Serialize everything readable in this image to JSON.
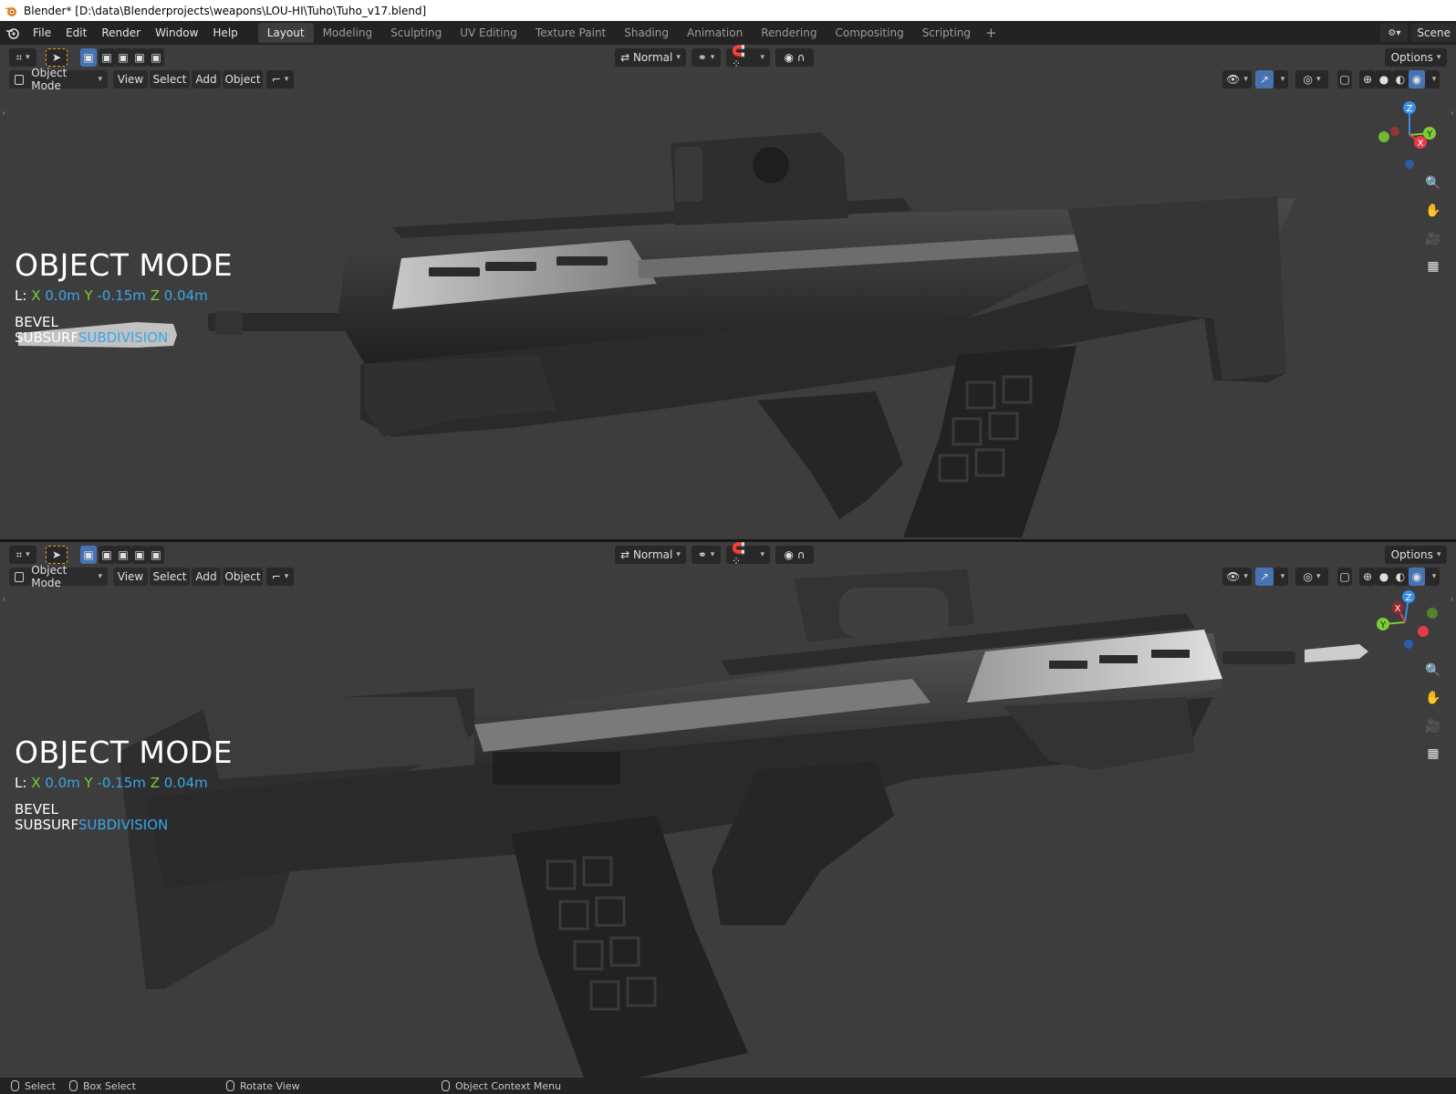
{
  "window": {
    "title": "Blender* [D:\\data\\Blenderprojects\\weapons\\LOU-HI\\Tuho\\Tuho_v17.blend]"
  },
  "menu": [
    "File",
    "Edit",
    "Render",
    "Window",
    "Help"
  ],
  "workspaces": [
    "Layout",
    "Modeling",
    "Sculpting",
    "UV Editing",
    "Texture Paint",
    "Shading",
    "Animation",
    "Rendering",
    "Compositing",
    "Scripting"
  ],
  "active_workspace": "Layout",
  "scene": {
    "label": "Scene"
  },
  "viewports": [
    {
      "toolbar": {
        "orientation": "Normal",
        "options": "Options"
      },
      "header": {
        "mode": "Object Mode",
        "menus": [
          "View",
          "Select",
          "Add",
          "Object"
        ]
      },
      "overlay": {
        "mode_title": "OBJECT MODE",
        "loc_label": "L:",
        "x_label": "X",
        "x_val": "0.0m",
        "y_label": "Y",
        "y_val": "-0.15m",
        "z_label": "Z",
        "z_val": "0.04m",
        "mod_line1": "BEVEL",
        "mod_line2_a": "SUBSURF",
        "mod_line2_b": "SUBDIVISION"
      },
      "gizmo_axes": {
        "z": "Z",
        "y": "Y",
        "x": "X"
      }
    },
    {
      "toolbar": {
        "orientation": "Normal",
        "options": "Options"
      },
      "header": {
        "mode": "Object Mode",
        "menus": [
          "View",
          "Select",
          "Add",
          "Object"
        ]
      },
      "overlay": {
        "mode_title": "OBJECT MODE",
        "loc_label": "L:",
        "x_label": "X",
        "x_val": "0.0m",
        "y_label": "Y",
        "y_val": "-0.15m",
        "z_label": "Z",
        "z_val": "0.04m",
        "mod_line1": "BEVEL",
        "mod_line2_a": "SUBSURF",
        "mod_line2_b": "SUBDIVISION"
      },
      "gizmo_axes": {
        "z": "Z",
        "y": "Y",
        "x": "X"
      }
    }
  ],
  "statusbar": {
    "select": "Select",
    "box_select": "Box Select",
    "rotate": "Rotate View",
    "context_menu": "Object Context Menu"
  },
  "colors": {
    "viewport_bg": "#3d3d3d",
    "header_bg": "#232323",
    "accent_blue": "#4772b3",
    "axis_x": "#e8394a",
    "axis_y": "#7ccd35",
    "axis_z": "#3a8ee8",
    "overlay_value": "#3aa6e8"
  }
}
